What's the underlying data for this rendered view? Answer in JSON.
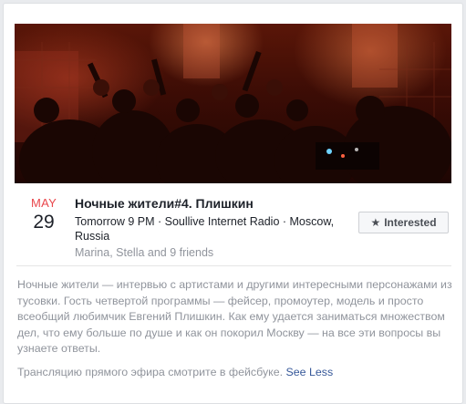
{
  "event": {
    "date_month": "MAY",
    "date_day": "29",
    "title": "Ночные жители#4. Плишкин",
    "meta": "Tomorrow 9 PM · Soullive Internet Radio · Moscow, Russia",
    "friends": "Marina, Stella and 9 friends",
    "interested_label": "Interested",
    "description": "Ночные жители — интервью с артистами и другими интересными персонажами из тусовки. Гость четвертой программы — фейсер, промоутер, модель и просто всеобщий любимчик Евгений Плишкин. Как ему удается заниматься множеством дел, что ему больше по душе и как он покорил Москву — на все эти вопросы вы узнаете ответы.",
    "note": "Трансляцию прямого эфира смотрите в фейсбуке.",
    "see_less_label": "See Less"
  },
  "colors": {
    "month_red": "#e9474c",
    "link_blue": "#365899",
    "muted_gray": "#90949c"
  },
  "icons": {
    "interested": "star-icon"
  }
}
